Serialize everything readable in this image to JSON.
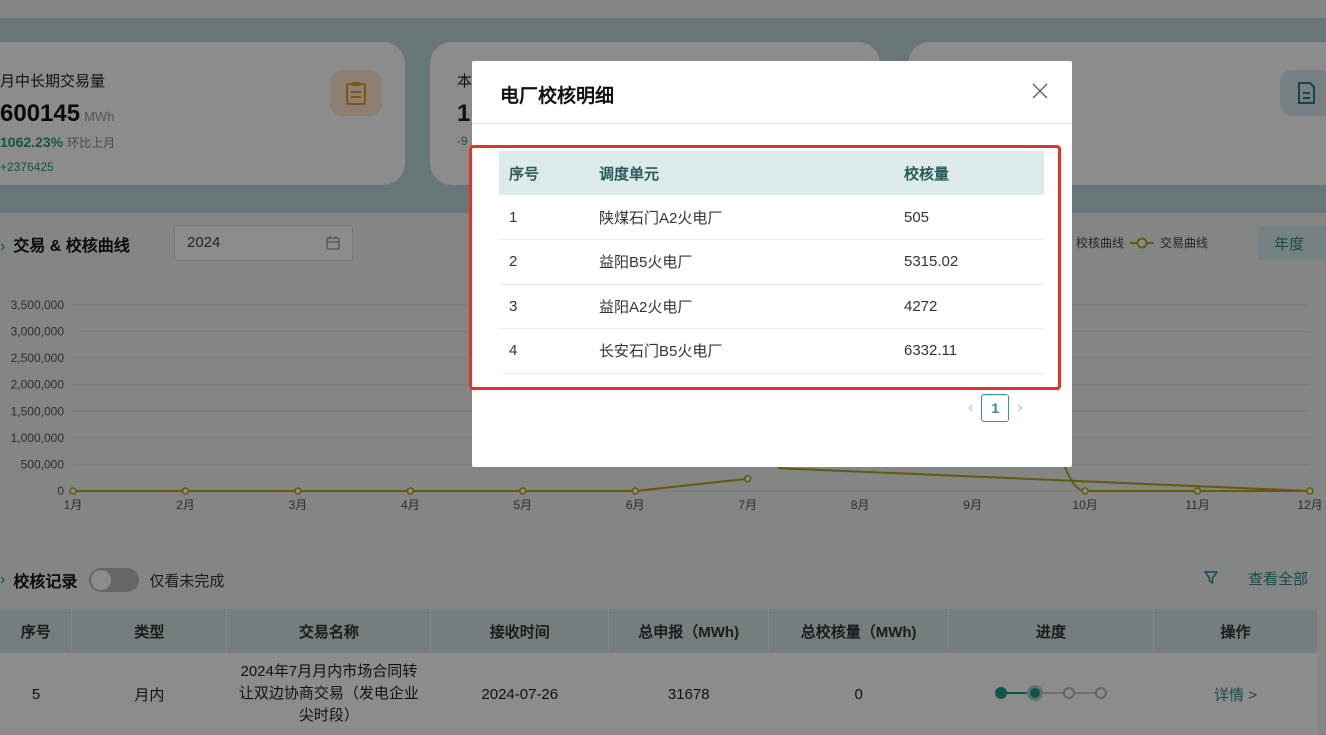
{
  "stats": {
    "card1": {
      "title": "月中长期交易量",
      "value": "600145",
      "unit": "MWh",
      "pct": "1062.23%",
      "pct_label": "环比上月",
      "delta": "+2376425"
    },
    "card2": {
      "title_partial": "本",
      "value_partial": "1",
      "pct_partial": "-9"
    }
  },
  "chart_section": {
    "title": "交易 & 校核曲线",
    "year_value": "2024",
    "legend": {
      "check_curve": "校核曲线",
      "trade_curve": "交易曲线"
    },
    "period_button": "年度"
  },
  "chart_data": {
    "type": "line",
    "x": [
      "1月",
      "2月",
      "3月",
      "4月",
      "5月",
      "6月",
      "7月",
      "8月",
      "9月",
      "10月",
      "11月",
      "12月"
    ],
    "y_ticks": [
      "3,500,000",
      "3,000,000",
      "2,500,000",
      "2,000,000",
      "1,500,000",
      "1,000,000",
      "500,000",
      "0"
    ],
    "ylim": [
      0,
      3500000
    ],
    "series": [
      {
        "name": "交易曲线",
        "values": [
          0,
          0,
          0,
          0,
          0,
          0,
          230000,
          null,
          null,
          0,
          0,
          0
        ]
      }
    ],
    "colors": {
      "trade_curve": "#b5a414",
      "grid": "#e2e2e2"
    }
  },
  "records": {
    "title": "校核记录",
    "toggle_label": "仅看未完成",
    "view_all": "查看全部",
    "columns": [
      "序号",
      "类型",
      "交易名称",
      "接收时间",
      "总申报（MWh)",
      "总校核量（MWh)",
      "进度",
      "操作"
    ],
    "row": {
      "seq": "5",
      "type": "月内",
      "name": "2024年7月月内市场合同转让双边协商交易（发电企业尖时段）",
      "time": "2024-07-26",
      "declared": "31678",
      "checked": "0",
      "action": "详情 >"
    }
  },
  "modal": {
    "title": "电厂校核明细",
    "columns": [
      "序号",
      "调度单元",
      "校核量"
    ],
    "rows": [
      {
        "seq": "1",
        "unit": "陕煤石门A2火电厂",
        "amount": "505"
      },
      {
        "seq": "2",
        "unit": "益阳B5火电厂",
        "amount": "5315.02"
      },
      {
        "seq": "3",
        "unit": "益阳A2火电厂",
        "amount": "4272"
      },
      {
        "seq": "4",
        "unit": "长安石门B5火电厂",
        "amount": "6332.11"
      }
    ],
    "page": "1",
    "highlight_color": "#e4312b"
  }
}
